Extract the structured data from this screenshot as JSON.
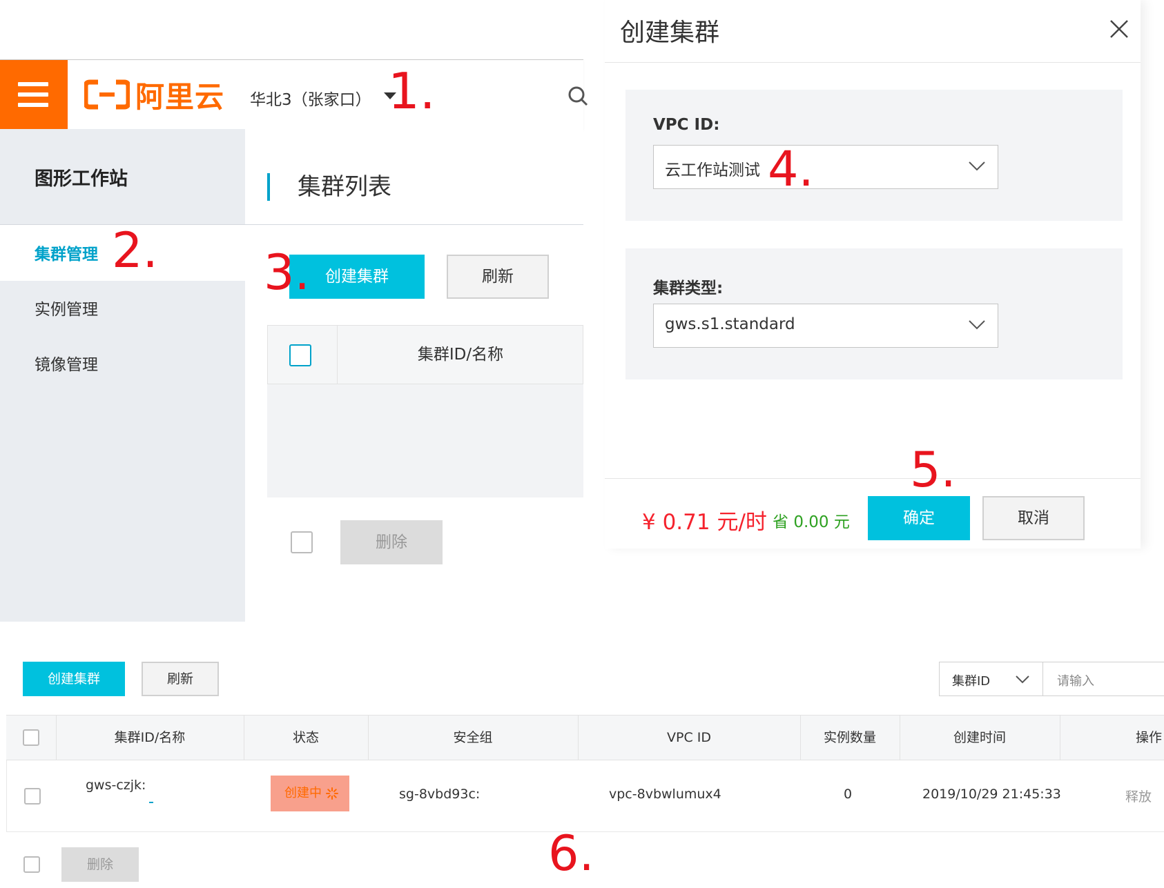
{
  "console": {
    "brand": "阿里云",
    "region": "华北3（张家口）",
    "sidebar": {
      "title": "图形工作站",
      "items": [
        {
          "label": "集群管理",
          "active": true
        },
        {
          "label": "实例管理"
        },
        {
          "label": "镜像管理"
        }
      ]
    },
    "page_title": "集群列表",
    "toolbar": {
      "create_label": "创建集群",
      "refresh_label": "刷新"
    },
    "table": {
      "col_id_name": "集群ID/名称"
    },
    "delete_label": "删除"
  },
  "dialog": {
    "title": "创建集群",
    "vpc_label": "VPC ID:",
    "vpc_value": "云工作站测试",
    "type_label": "集群类型:",
    "type_value": "gws.s1.standard",
    "price": "¥ 0.71 元/时",
    "save_prefix": "省",
    "save_value": "0.00 元",
    "confirm_label": "确定",
    "cancel_label": "取消"
  },
  "list_view": {
    "create_label": "创建集群",
    "refresh_label": "刷新",
    "filter_field": "集群ID",
    "filter_placeholder": "请输入",
    "columns": [
      "集群ID/名称",
      "状态",
      "安全组",
      "VPC ID",
      "实例数量",
      "创建时间",
      "操作"
    ],
    "row": {
      "id": "gws-czjk:",
      "status": "创建中",
      "security_group": "sg-8vbd93c:",
      "vpc_id": "vpc-8vbwlumux4",
      "instances": "0",
      "created": "2019/10/29 21:45:33",
      "action": "释放"
    },
    "delete_label": "删除"
  },
  "steps": [
    "1.",
    "2.",
    "3.",
    "4.",
    "5.",
    "6."
  ],
  "colors": {
    "brand_orange": "#ff6a00",
    "primary_cyan": "#00c1de",
    "step_red": "#e8141e",
    "price_red": "#f5222d",
    "save_green": "#2ea121"
  }
}
